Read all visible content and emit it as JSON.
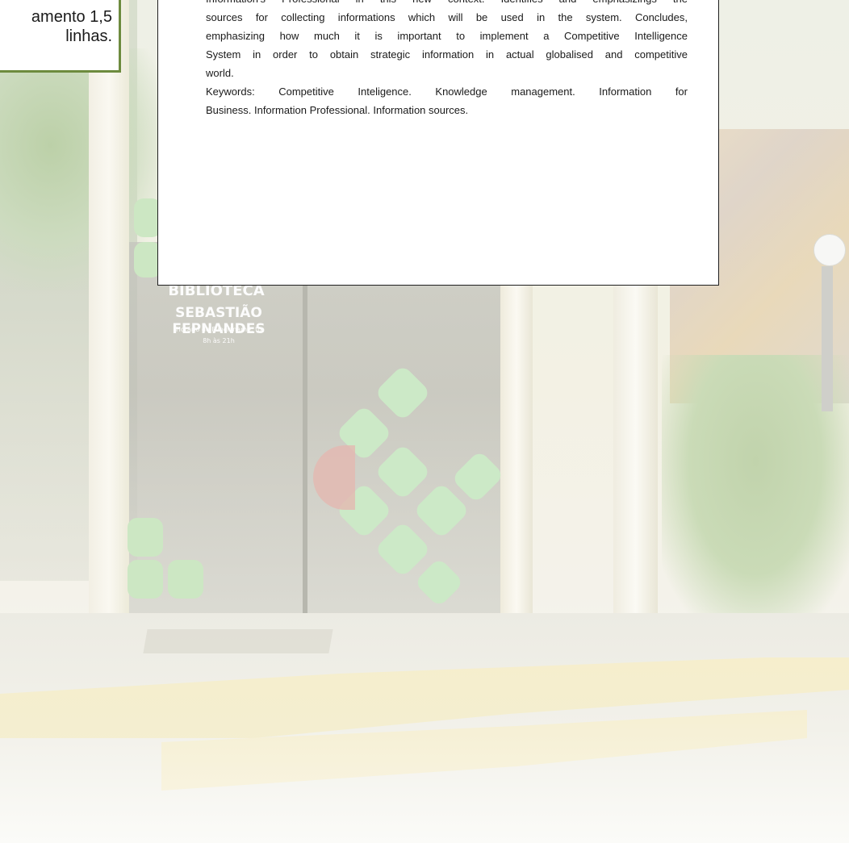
{
  "note": {
    "lines": [
      "amento 1,5",
      "linhas."
    ],
    "border_color": "#6d8b3e"
  },
  "abstract": {
    "lines": [
      "Information's Professional in this new context. Identifies and emphasizings the",
      "sources for collecting informations which will be used in the system. Concludes,",
      "emphasizing how much it is important to implement a Competitive Intelligence",
      "System in order to obtain strategic information in actual globalised and competitive",
      "world."
    ],
    "keywords_lines": [
      "Keywords: Competitive Inteligence. Knowledge management. Information for",
      "Business. Information Professional. Information sources."
    ]
  },
  "background_sign": {
    "line1": "BIBLIOTECA",
    "line2": "SEBASTIÃO FEPNANDES",
    "line3": "Horário de Funcioname: to",
    "line4": "8h às 21h"
  },
  "colors": {
    "logo_green": "#cce7c3",
    "logo_red": "#e3b8b0"
  }
}
